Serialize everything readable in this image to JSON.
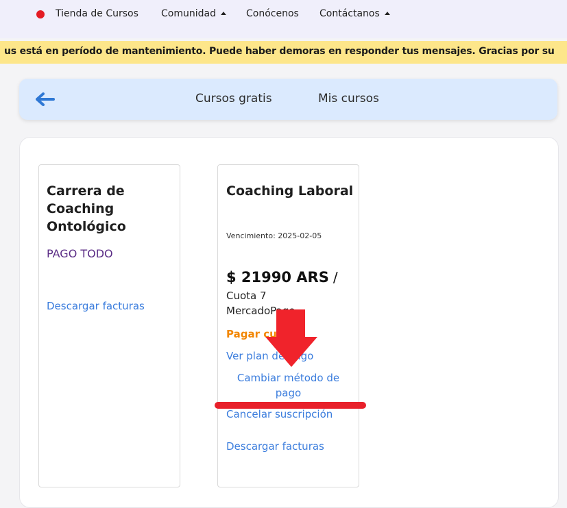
{
  "topnav": {
    "items": [
      {
        "label": "Tienda de Cursos"
      },
      {
        "label": "Comunidad"
      },
      {
        "label": "Conócenos"
      },
      {
        "label": "Contáctanos"
      }
    ]
  },
  "banner": {
    "text": "us está en período de mantenimiento. Puede haber demoras en responder tus mensajes. Gracias por su"
  },
  "subnav": {
    "links": [
      "Cursos gratis",
      "Mis cursos"
    ]
  },
  "cards": [
    {
      "title_lines": [
        "Carrera de",
        "Coaching",
        "Ontológico"
      ],
      "status": "PAGO TODO",
      "download_invoices": "Descargar facturas"
    },
    {
      "title": "Coaching Laboral",
      "expiry": "Vencimiento: 2025-02-05",
      "price": "$ 21990 ARS",
      "price_sep": "/",
      "installment": "Cuota 7",
      "provider": "MercadoPago",
      "pay_installment": "Pagar cuota",
      "view_plan": "Ver plan de pago",
      "change_method_lines": [
        "Cambiar método de",
        "pago"
      ],
      "cancel_subscription": "Cancelar suscripción",
      "download_invoices": "Descargar facturas"
    }
  ],
  "colors": {
    "nav_bg": "#f0effb",
    "banner_bg": "#fde68a",
    "subnav_bg": "#dbeafe",
    "link": "#3b7ddd",
    "accent_orange": "#f28705",
    "status_purple": "#5b2d86",
    "annotation_red": "#e8202a"
  }
}
